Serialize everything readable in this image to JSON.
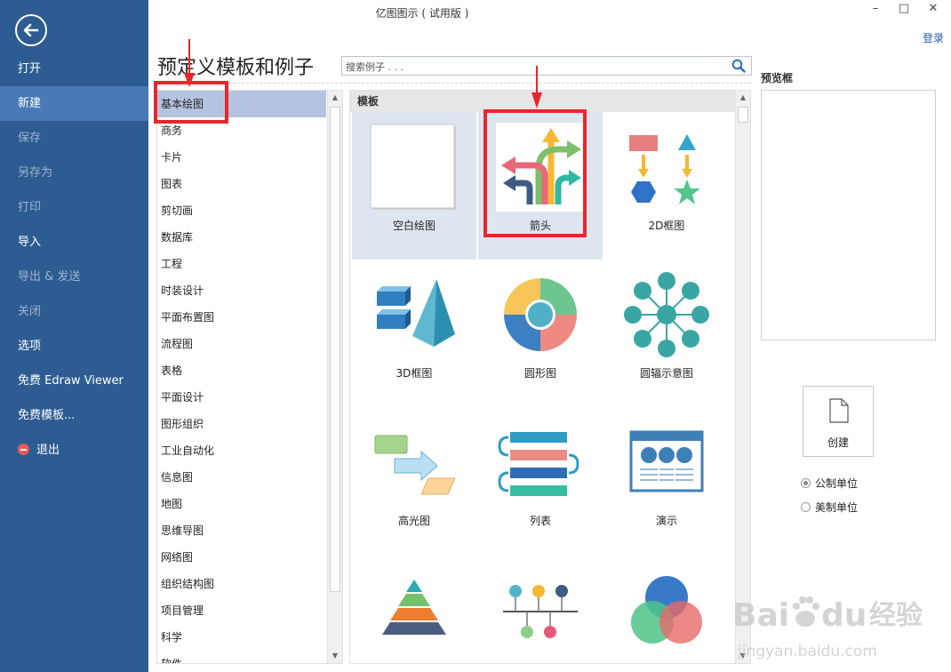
{
  "window": {
    "title": "亿图图示 ( 试用版 )",
    "login": "登录",
    "minimize": "–",
    "maximize": "□",
    "close": "✕"
  },
  "sidebar": {
    "items": [
      {
        "label": "打开"
      },
      {
        "label": "新建"
      },
      {
        "label": "保存"
      },
      {
        "label": "另存为"
      },
      {
        "label": "打印"
      },
      {
        "label": "导入"
      },
      {
        "label": "导出 & 发送"
      },
      {
        "label": "关闭"
      },
      {
        "label": "选项"
      },
      {
        "label": "免费 Edraw Viewer"
      },
      {
        "label": "免费模板..."
      },
      {
        "label": "退出"
      }
    ]
  },
  "main": {
    "heading": "预定义模板和例子",
    "search": {
      "placeholder": "搜索例子 . . ."
    },
    "categories": [
      "基本绘图",
      "商务",
      "卡片",
      "图表",
      "剪切画",
      "数据库",
      "工程",
      "时装设计",
      "平面布置图",
      "流程图",
      "表格",
      "平面设计",
      "图形组织",
      "工业自动化",
      "信息图",
      "地图",
      "思维导图",
      "网络图",
      "组织结构图",
      "项目管理",
      "科学",
      "软件"
    ],
    "templates_header": "模板",
    "templates": [
      {
        "label": "空白绘图"
      },
      {
        "label": "箭头"
      },
      {
        "label": "2D框图"
      },
      {
        "label": "3D框图"
      },
      {
        "label": "圆形图"
      },
      {
        "label": "圆辐示意图"
      },
      {
        "label": "高光图"
      },
      {
        "label": "列表"
      },
      {
        "label": "演示"
      },
      {
        "label": ""
      },
      {
        "label": ""
      },
      {
        "label": ""
      }
    ]
  },
  "preview": {
    "label": "预览框",
    "create": "创建",
    "units": [
      {
        "label": "公制单位",
        "selected": true
      },
      {
        "label": "美制单位",
        "selected": false
      }
    ]
  },
  "watermark": {
    "text": "Baidu经验",
    "url": "jingyan.baidu.com"
  }
}
